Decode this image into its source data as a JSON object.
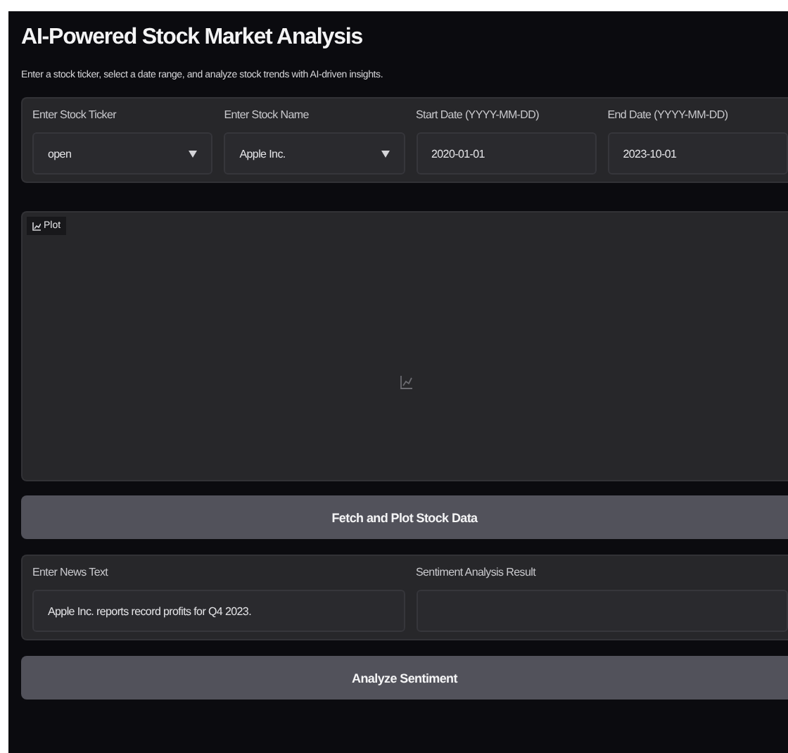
{
  "title": "AI-Powered Stock Market Analysis",
  "description": "Enter a stock ticker, select a date range, and analyze stock trends with AI-driven insights.",
  "inputs": [
    {
      "kind": "dropdown",
      "label": "Enter Stock Ticker",
      "value": "open"
    },
    {
      "kind": "dropdown",
      "label": "Enter Stock Name",
      "value": "Apple Inc."
    },
    {
      "kind": "text",
      "label": "Start Date (YYYY-MM-DD)",
      "value": "2020-01-01"
    },
    {
      "kind": "text",
      "label": "End Date (YYYY-MM-DD)",
      "value": "2023-10-01"
    }
  ],
  "plot": {
    "label": "Plot"
  },
  "fetch_button": "Fetch and Plot Stock Data",
  "sentiment": [
    {
      "label": "Enter News Text",
      "value": "Apple Inc. reports record profits for Q4 2023."
    },
    {
      "label": "Sentiment Analysis Result"
    }
  ],
  "analyze_button": "Analyze Sentiment"
}
